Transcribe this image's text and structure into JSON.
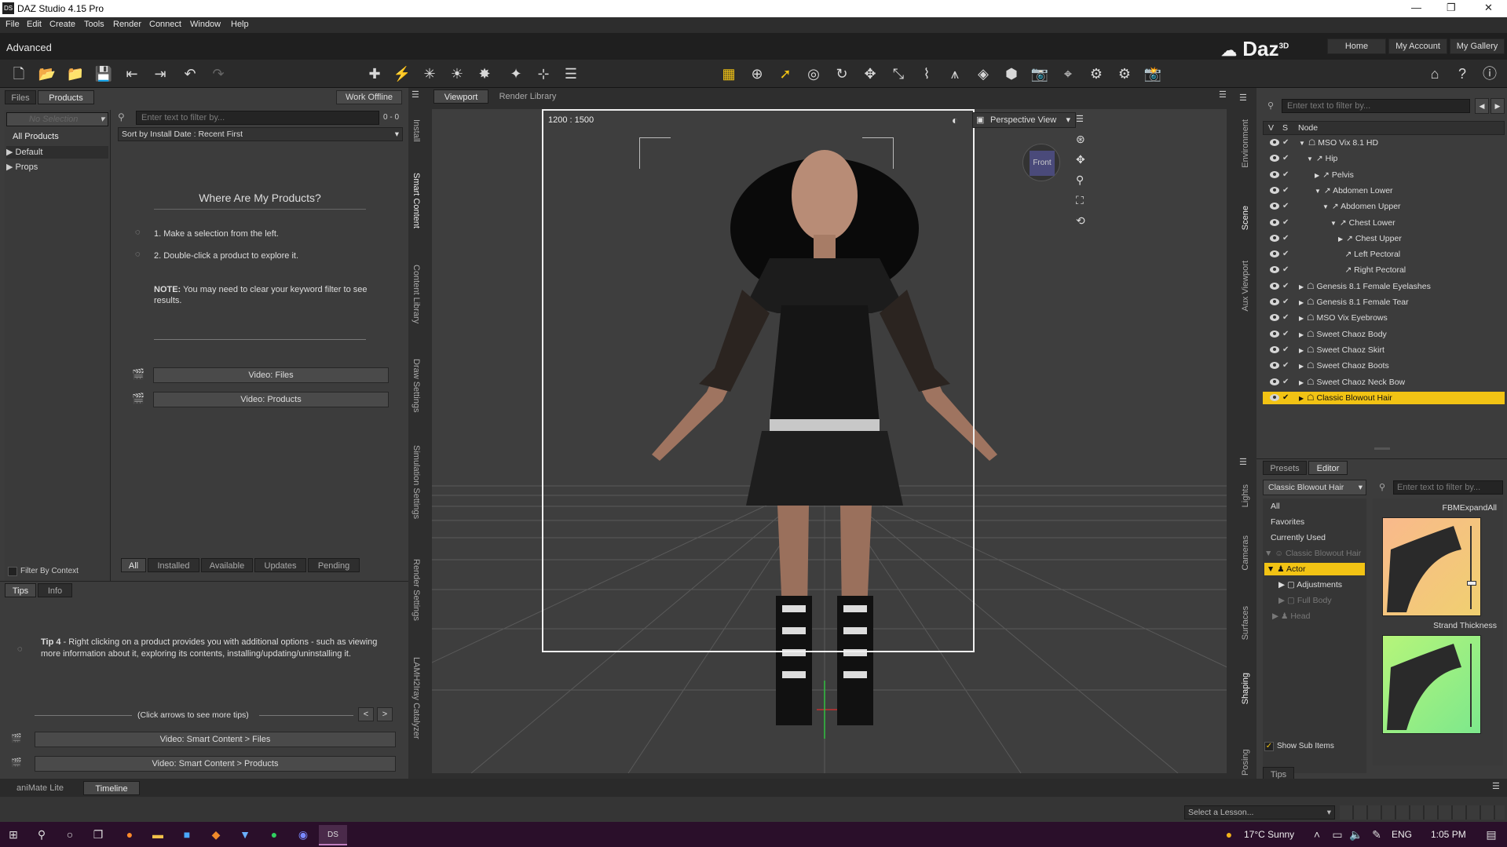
{
  "window": {
    "title": "DAZ Studio 4.15 Pro"
  },
  "menu": [
    "File",
    "Edit",
    "Create",
    "Tools",
    "Render",
    "Connect",
    "Window",
    "Help"
  ],
  "layout": {
    "name": "Advanced",
    "brand": "Daz",
    "brand_sup": "3D",
    "nav": [
      "Home",
      "My Account",
      "My Gallery"
    ]
  },
  "left": {
    "tabs": [
      "Files",
      "Products"
    ],
    "work_offline": "Work Offline",
    "selection": "No Selection",
    "filter_placeholder": "Enter text to filter by...",
    "count": "0 - 0",
    "tree": [
      "All Products",
      "Default",
      "Props"
    ],
    "sort": "Sort by Install Date : Recent First",
    "heading": "Where Are My Products?",
    "step1": "1. Make a selection from the left.",
    "step2": "2. Double-click a product to explore it.",
    "note_label": "NOTE:",
    "note": "You may need to clear your keyword filter to see results.",
    "video_files": "Video: Files",
    "video_products": "Video: Products",
    "filter_context": "Filter By Context",
    "bottom_tabs": [
      "All",
      "Installed",
      "Available",
      "Updates",
      "Pending"
    ],
    "side_tabs": [
      "Install",
      "Smart Content",
      "Content Library",
      "Draw Settings",
      "Simulation Settings",
      "Render Settings",
      "LAMH2Iray Catalyzer"
    ]
  },
  "tips": {
    "tabs": [
      "Tips",
      "Info"
    ],
    "label": "Tip 4",
    "text": " - Right clicking on a product provides you with additional options - such as viewing more information about it, exploring its contents, installing/updating/uninstalling it.",
    "hint": "(Click arrows to see more tips)",
    "prev": "<",
    "next": ">",
    "video_sc_files": "Video: Smart Content > Files",
    "video_sc_products": "Video: Smart Content > Products"
  },
  "viewport": {
    "tabs": [
      "Viewport",
      "Render Library"
    ],
    "resolution": "1200 : 1500",
    "view": "Perspective View",
    "cube": "Front"
  },
  "scene": {
    "filter_placeholder": "Enter text to filter by...",
    "cols": [
      "V",
      "S",
      "Node"
    ],
    "nodes": [
      {
        "label": "MSO Vix 8.1 HD",
        "indent": 0,
        "arrow": "▼"
      },
      {
        "label": "Hip",
        "indent": 1,
        "arrow": "▼"
      },
      {
        "label": "Pelvis",
        "indent": 2,
        "arrow": "▶"
      },
      {
        "label": "Abdomen Lower",
        "indent": 2,
        "arrow": "▼"
      },
      {
        "label": "Abdomen Upper",
        "indent": 3,
        "arrow": "▼"
      },
      {
        "label": "Chest Lower",
        "indent": 4,
        "arrow": "▼"
      },
      {
        "label": "Chest Upper",
        "indent": 5,
        "arrow": "▶"
      },
      {
        "label": "Left Pectoral",
        "indent": 5,
        "arrow": ""
      },
      {
        "label": "Right Pectoral",
        "indent": 5,
        "arrow": ""
      },
      {
        "label": "Genesis 8.1 Female Eyelashes",
        "indent": 0,
        "arrow": "▶"
      },
      {
        "label": "Genesis 8.1 Female Tear",
        "indent": 0,
        "arrow": "▶"
      },
      {
        "label": "MSO Vix Eyebrows",
        "indent": 0,
        "arrow": "▶"
      },
      {
        "label": "Sweet Chaoz Body",
        "indent": 0,
        "arrow": "▶"
      },
      {
        "label": "Sweet Chaoz Skirt",
        "indent": 0,
        "arrow": "▶"
      },
      {
        "label": "Sweet Chaoz Boots",
        "indent": 0,
        "arrow": "▶"
      },
      {
        "label": "Sweet Chaoz Neck Bow",
        "indent": 0,
        "arrow": "▶"
      },
      {
        "label": "Classic Blowout Hair",
        "indent": 0,
        "arrow": "▶"
      }
    ],
    "side_tabs": [
      "Environment",
      "Scene",
      "Aux Viewport"
    ]
  },
  "editor": {
    "tabs": [
      "Presets",
      "Editor"
    ],
    "dropdown": "Classic Blowout Hair",
    "filter_placeholder": "Enter text to filter by...",
    "groups": [
      "All",
      "Favorites",
      "Currently Used"
    ],
    "tree": [
      "Classic Blowout Hair",
      "Actor",
      "Adjustments",
      "Full Body",
      "Head"
    ],
    "show_sub": "Show Sub Items",
    "slider1": "FBMExpandAll",
    "slider2": "Strand Thickness",
    "tips": "Tips",
    "side_tabs": [
      "Lights",
      "Cameras",
      "Surfaces",
      "Shaping",
      "Posing"
    ]
  },
  "timeline": {
    "tabs": [
      "aniMate Lite",
      "Timeline"
    ],
    "lesson": "Select a Lesson..."
  },
  "taskbar": {
    "weather": "17°C  Sunny",
    "lang": "ENG",
    "time": "1:05 PM"
  },
  "colors": {
    "accent": "#f2c314",
    "viewport_bg": "#3e3e3e"
  }
}
